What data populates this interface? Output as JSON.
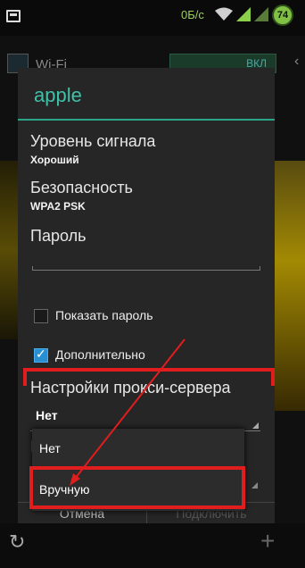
{
  "status_bar": {
    "speed": "0Б/с",
    "battery": "74"
  },
  "wifi_screen": {
    "title": "Wi-Fi",
    "toggle_label": "ВКЛ"
  },
  "dialog": {
    "network_name": "apple",
    "signal_label": "Уровень сигнала",
    "signal_value": "Хороший",
    "security_label": "Безопасность",
    "security_value": "WPA2 PSK",
    "password_label": "Пароль",
    "password_value": "",
    "show_password_label": "Показать пароль",
    "show_password_checked": false,
    "advanced_label": "Дополнительно",
    "advanced_checked": true,
    "proxy_label": "Настройки прокси-сервера",
    "proxy_selected": "Нет",
    "cancel_label": "Отмена",
    "connect_label": "Подключить"
  },
  "proxy_dropdown": {
    "options": [
      "Нет",
      "Вручную"
    ]
  },
  "colors": {
    "accent": "#3fc2a8",
    "highlight": "#e21d1d"
  }
}
